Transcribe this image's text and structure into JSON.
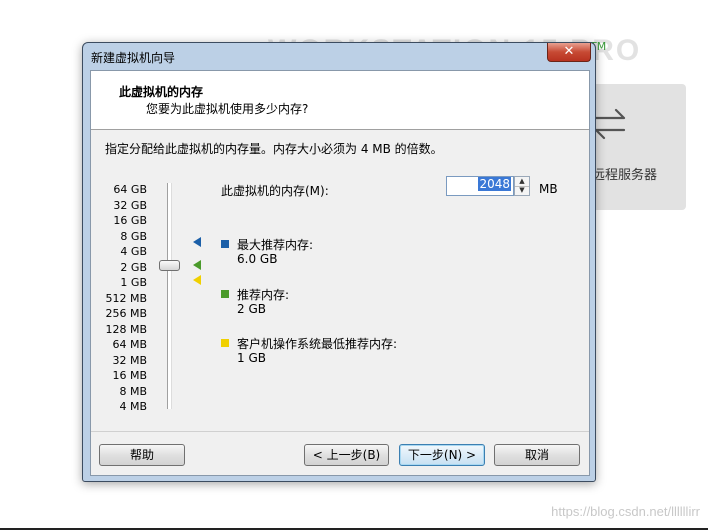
{
  "background": {
    "watermark": "WORKSTATION 15 PRO",
    "tm": "TM",
    "card_label": "远程服务器",
    "url": "https://blog.csdn.net/llllllirr"
  },
  "window": {
    "title": "新建虚拟机向导",
    "close_label": "✕"
  },
  "header": {
    "title": "此虚拟机的内存",
    "subtitle": "您要为此虚拟机使用多少内存?"
  },
  "instruction": "指定分配给此虚拟机的内存量。内存大小必须为 4 MB 的倍数。",
  "scale_labels": [
    "64 GB",
    "32 GB",
    "16 GB",
    "8 GB",
    "4 GB",
    "2 GB",
    "1 GB",
    "512 MB",
    "256 MB",
    "128 MB",
    "64 MB",
    "32 MB",
    "16 MB",
    "8 MB",
    "4 MB"
  ],
  "memory": {
    "label": "此虚拟机的内存(M):",
    "value": "2048",
    "unit": "MB"
  },
  "legend": [
    {
      "title": "最大推荐内存:",
      "value": "6.0 GB",
      "color": "#1b5fa8"
    },
    {
      "title": "推荐内存:",
      "value": "2 GB",
      "color": "#4a9a2a"
    },
    {
      "title": "客户机操作系统最低推荐内存:",
      "value": "1 GB",
      "color": "#f0d000"
    }
  ],
  "buttons": {
    "help": "帮助",
    "back": "< 上一步(B)",
    "next": "下一步(N) >",
    "cancel": "取消"
  }
}
